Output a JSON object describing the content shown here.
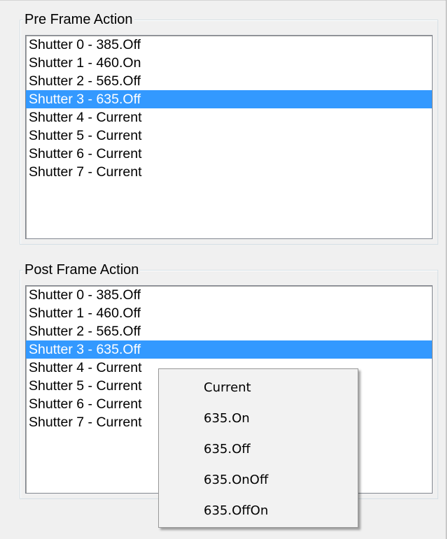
{
  "pre_frame": {
    "title": "Pre Frame Action",
    "items": [
      {
        "label": "Shutter 0 - 385.Off"
      },
      {
        "label": "Shutter 1 - 460.On"
      },
      {
        "label": "Shutter 2 - 565.Off"
      },
      {
        "label": "Shutter 3 - 635.Off",
        "selected": true
      },
      {
        "label": "Shutter 4 - Current"
      },
      {
        "label": "Shutter 5 - Current"
      },
      {
        "label": "Shutter 6 - Current"
      },
      {
        "label": "Shutter 7 - Current"
      }
    ]
  },
  "post_frame": {
    "title": "Post Frame Action",
    "items": [
      {
        "label": "Shutter 0 - 385.Off"
      },
      {
        "label": "Shutter 1 - 460.Off"
      },
      {
        "label": "Shutter 2 - 565.Off"
      },
      {
        "label": "Shutter 3 - 635.Off",
        "selected": true
      },
      {
        "label": "Shutter 4 - Current"
      },
      {
        "label": "Shutter 5 - Current"
      },
      {
        "label": "Shutter 6 - Current"
      },
      {
        "label": "Shutter 7 - Current"
      }
    ]
  },
  "context_menu": {
    "items": [
      {
        "label": "Current"
      },
      {
        "label": "635.On"
      },
      {
        "label": "635.Off"
      },
      {
        "label": "635.OnOff"
      },
      {
        "label": "635.OffOn"
      }
    ]
  },
  "colors": {
    "selection": "#3399ff",
    "background": "#f0f0f0",
    "list_background": "#ffffff"
  }
}
